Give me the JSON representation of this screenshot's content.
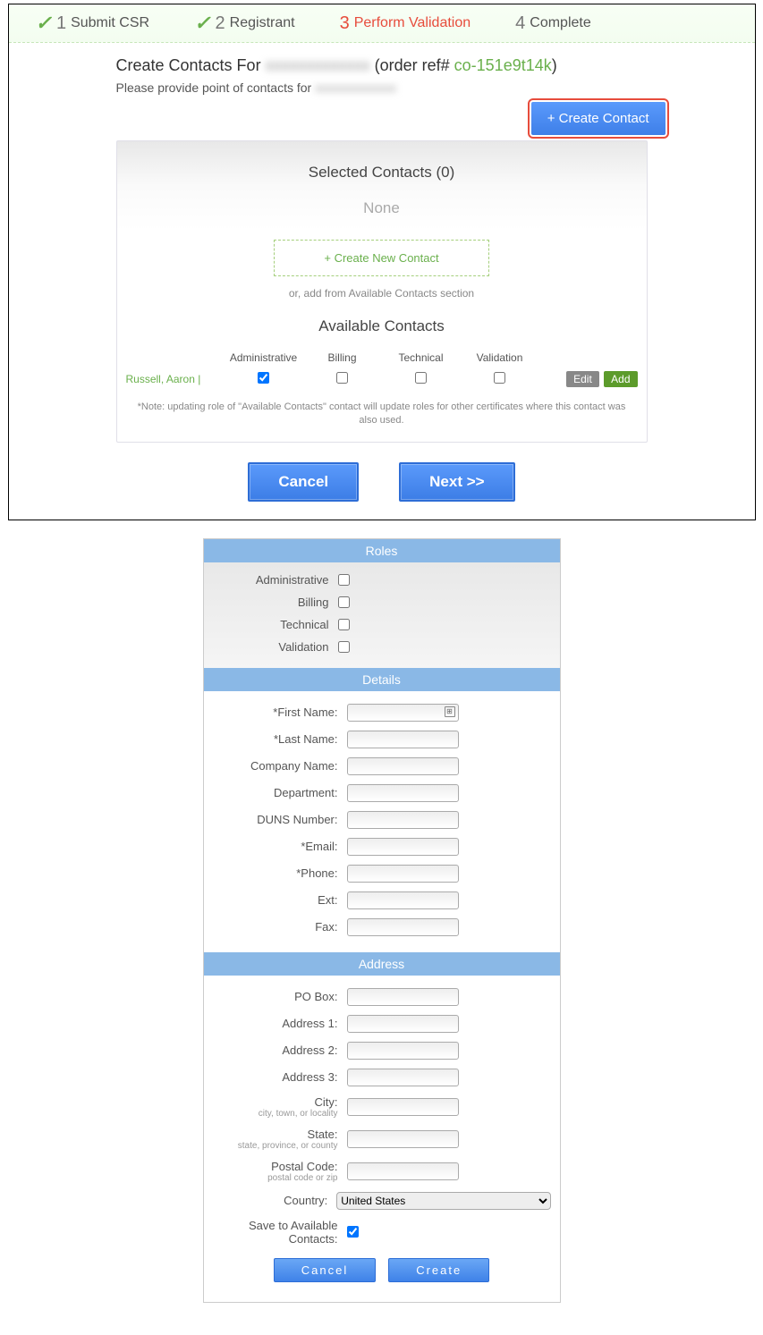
{
  "steps": [
    {
      "num": "1",
      "label": "Submit CSR",
      "done": true
    },
    {
      "num": "2",
      "label": "Registrant",
      "done": true
    },
    {
      "num": "3",
      "label": "Perform Validation",
      "active": true
    },
    {
      "num": "4",
      "label": "Complete"
    }
  ],
  "title_prefix": "Create Contacts For",
  "blurred_domain": "xxxxxxxxxxxxx",
  "title_order_prefix": "(order ref#",
  "order_ref": "co-151e9t14k",
  "title_order_suffix": ")",
  "subtitle_prefix": "Please provide point of contacts for",
  "create_contact_btn": "+ Create Contact",
  "selected_heading": "Selected Contacts (0)",
  "none_text": "None",
  "create_new_contact": "+ Create New Contact",
  "or_text": "or, add from Available Contacts section",
  "available_heading": "Available Contacts",
  "columns": {
    "admin": "Administrative",
    "billing": "Billing",
    "technical": "Technical",
    "validation": "Validation"
  },
  "contact_name": "Russell, Aaron |",
  "edit_label": "Edit",
  "add_label": "Add",
  "note": "*Note: updating role of \"Available Contacts\" contact will update roles for other certificates where this contact was also used.",
  "cancel_label": "Cancel",
  "next_label": "Next >>",
  "sections": {
    "roles": "Roles",
    "details": "Details",
    "address": "Address"
  },
  "roles": [
    "Administrative",
    "Billing",
    "Technical",
    "Validation"
  ],
  "details_fields": [
    "*First Name:",
    "*Last Name:",
    "Company Name:",
    "Department:",
    "DUNS Number:",
    "*Email:",
    "*Phone:",
    "Ext:",
    "Fax:"
  ],
  "address_fields": [
    {
      "label": "PO Box:"
    },
    {
      "label": "Address 1:"
    },
    {
      "label": "Address 2:"
    },
    {
      "label": "Address 3:"
    },
    {
      "label": "City:",
      "hint": "city, town, or locality"
    },
    {
      "label": "State:",
      "hint": "state, province, or county"
    },
    {
      "label": "Postal Code:",
      "hint": "postal code or zip"
    }
  ],
  "country_label": "Country:",
  "country_value": "United States",
  "save_label": "Save to Available Contacts:",
  "form_cancel": "Cancel",
  "form_create": "Create"
}
